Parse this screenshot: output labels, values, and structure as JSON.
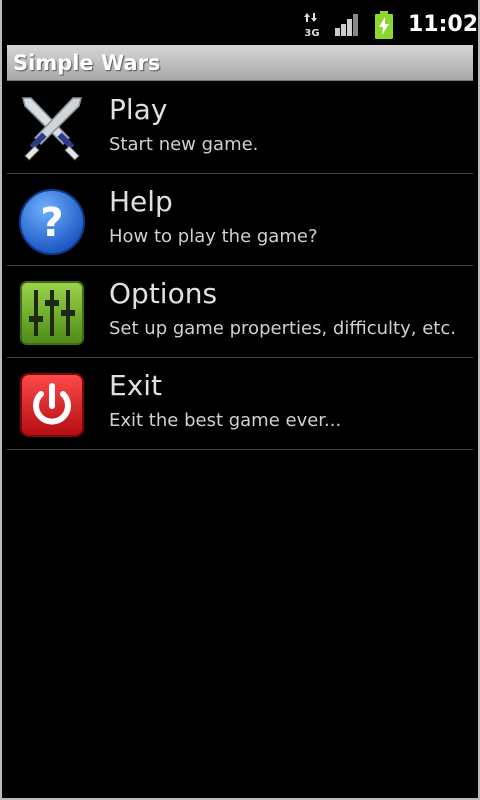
{
  "status_bar": {
    "network_label": "3G",
    "time": "11:02",
    "icons": [
      "network-3g-icon",
      "signal-icon",
      "battery-charging-icon"
    ],
    "colors": {
      "battery": "#8bd62f"
    }
  },
  "app": {
    "title": "Simple Wars"
  },
  "menu": {
    "items": [
      {
        "label": "Play",
        "description": "Start new game.",
        "icon": "crossed-swords-icon"
      },
      {
        "label": "Help",
        "description": "How to play the game?",
        "icon": "question-mark-icon"
      },
      {
        "label": "Options",
        "description": "Set up game properties, difficulty, etc.",
        "icon": "sliders-icon"
      },
      {
        "label": "Exit",
        "description": "Exit the best game ever...",
        "icon": "power-icon"
      }
    ]
  },
  "colors": {
    "help_icon": "#2a6fd8",
    "options_icon": "#6fa52a",
    "exit_icon": "#d8181e"
  }
}
